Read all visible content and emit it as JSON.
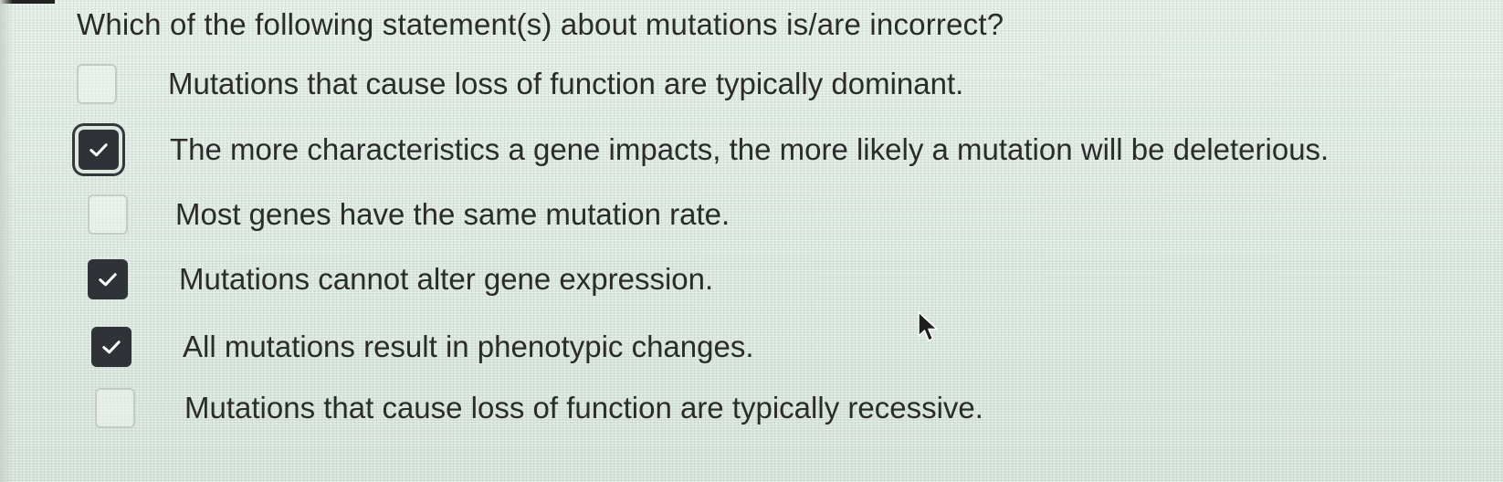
{
  "question": "Which of the following statement(s) about mutations is/are incorrect?",
  "options": [
    {
      "label": "Mutations that cause loss of function are typically dominant.",
      "checked": false
    },
    {
      "label": "The more characteristics a gene impacts, the more likely a mutation will be deleterious.",
      "checked": true,
      "focused": true
    },
    {
      "label": "Most genes have the same mutation rate.",
      "checked": false
    },
    {
      "label": "Mutations cannot alter gene expression.",
      "checked": true
    },
    {
      "label": "All mutations result in phenotypic changes.",
      "checked": true
    },
    {
      "label": "Mutations that cause loss of function are typically recessive.",
      "checked": false
    }
  ],
  "icons": {
    "checkmark": "check-icon",
    "cursor": "mouse-pointer-icon"
  },
  "colors": {
    "checked_fill": "#2f3337",
    "unchecked_border": "#c4ccc6",
    "text": "#2b2b2b"
  }
}
